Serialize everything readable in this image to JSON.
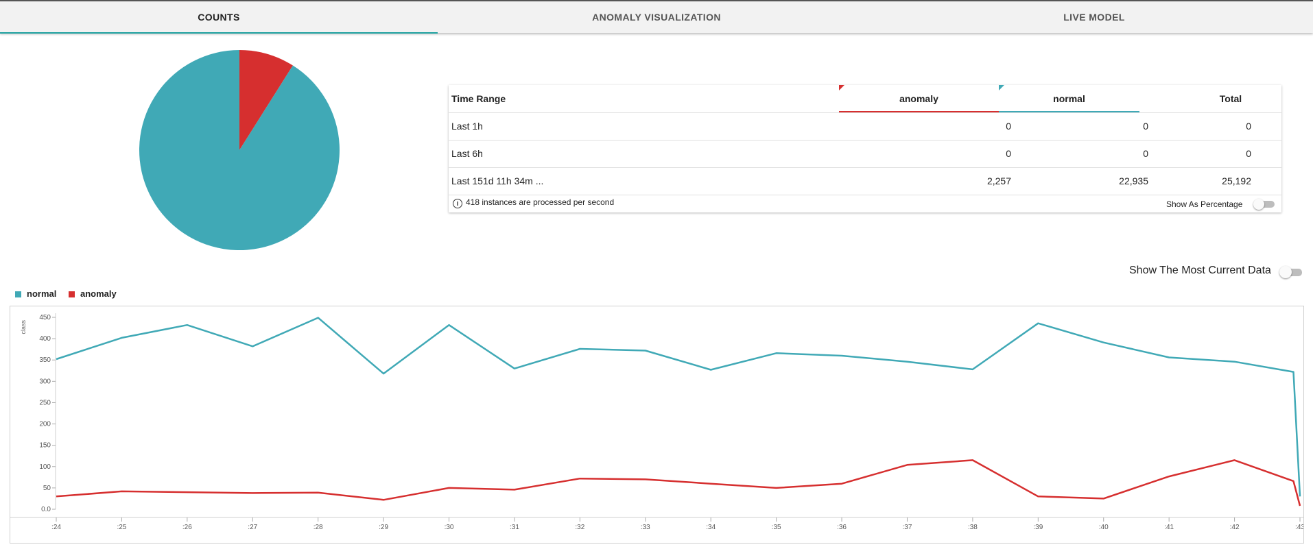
{
  "tabs": [
    {
      "label": "COUNTS",
      "active": true
    },
    {
      "label": "ANOMALY VISUALIZATION",
      "active": false
    },
    {
      "label": "LIVE MODEL",
      "active": false
    }
  ],
  "colors": {
    "anomaly": "#d62f2f",
    "normal": "#40a9b6",
    "accent": "#1fa1a0"
  },
  "pie": {
    "slices": [
      {
        "name": "anomaly",
        "value": 2257,
        "color": "#d62f2f"
      },
      {
        "name": "normal",
        "value": 22935,
        "color": "#40a9b6"
      }
    ]
  },
  "table": {
    "headers": {
      "time_range": "Time Range",
      "anomaly": "anomaly",
      "normal": "normal",
      "total": "Total"
    },
    "rows": [
      {
        "label": "Last 1h",
        "anomaly": "0",
        "normal": "0",
        "total": "0"
      },
      {
        "label": "Last 6h",
        "anomaly": "0",
        "normal": "0",
        "total": "0"
      },
      {
        "label": "Last 151d 11h 34m ...",
        "anomaly": "2,257",
        "normal": "22,935",
        "total": "25,192"
      }
    ],
    "footer_info": "418 instances are processed per second",
    "show_percentage_label": "Show As Percentage",
    "show_percentage_on": false
  },
  "current_data": {
    "label": "Show The Most Current Data",
    "on": false
  },
  "chart_data": {
    "type": "line",
    "ylabel": "class",
    "ylim": [
      0,
      450
    ],
    "yticks": [
      "0.0",
      "50",
      "100",
      "150",
      "200",
      "250",
      "300",
      "350",
      "400",
      "450"
    ],
    "categories": [
      ":24",
      ":25",
      ":26",
      ":27",
      ":28",
      ":29",
      ":30",
      ":31",
      ":32",
      ":33",
      ":34",
      ":35",
      ":36",
      ":37",
      ":38",
      ":39",
      ":40",
      ":41",
      ":42",
      ":43"
    ],
    "x": [
      24,
      25,
      26,
      27,
      28,
      29,
      30,
      31,
      32,
      33,
      34,
      35,
      36,
      37,
      38,
      39,
      40,
      41,
      42,
      43
    ],
    "legend_position": "top-left",
    "series": [
      {
        "name": "normal",
        "color": "#40a9b6",
        "points": [
          [
            24,
            352
          ],
          [
            25,
            402
          ],
          [
            26,
            432
          ],
          [
            27,
            382
          ],
          [
            28,
            449
          ],
          [
            29,
            318
          ],
          [
            30,
            432
          ],
          [
            31,
            330
          ],
          [
            32,
            376
          ],
          [
            33,
            372
          ],
          [
            34,
            327
          ],
          [
            35,
            366
          ],
          [
            36,
            360
          ],
          [
            37,
            346
          ],
          [
            38,
            328
          ],
          [
            39,
            436
          ],
          [
            40,
            391
          ],
          [
            41,
            356
          ],
          [
            42,
            346
          ],
          [
            42.9,
            322
          ],
          [
            43,
            30
          ]
        ]
      },
      {
        "name": "anomaly",
        "color": "#d62f2f",
        "points": [
          [
            24,
            30
          ],
          [
            25,
            42
          ],
          [
            26,
            40
          ],
          [
            27,
            38
          ],
          [
            28,
            39
          ],
          [
            29,
            22
          ],
          [
            30,
            50
          ],
          [
            31,
            46
          ],
          [
            32,
            72
          ],
          [
            33,
            70
          ],
          [
            34,
            60
          ],
          [
            35,
            50
          ],
          [
            36,
            60
          ],
          [
            37,
            104
          ],
          [
            38,
            115
          ],
          [
            39,
            30
          ],
          [
            40,
            25
          ],
          [
            41,
            77
          ],
          [
            42,
            115
          ],
          [
            42.9,
            66
          ],
          [
            43,
            8
          ]
        ]
      }
    ]
  }
}
